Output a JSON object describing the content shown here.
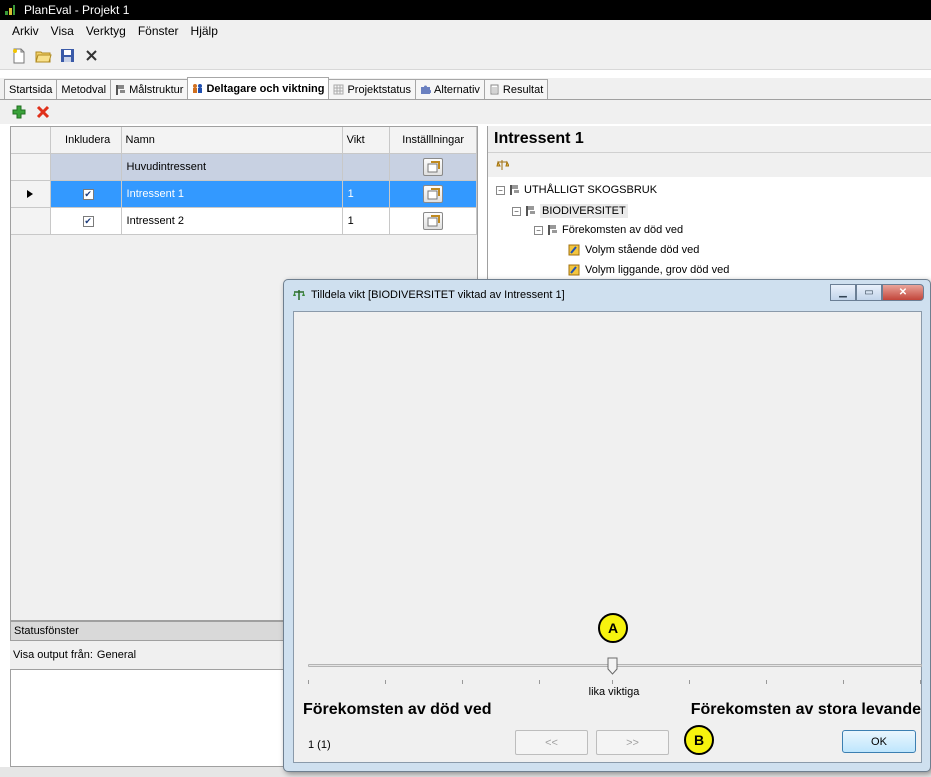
{
  "window": {
    "title": "PlanEval - Projekt 1"
  },
  "menu": [
    "Arkiv",
    "Visa",
    "Verktyg",
    "Fönster",
    "Hjälp"
  ],
  "tabs": [
    {
      "label": "Startsida",
      "icon": "none"
    },
    {
      "label": "Metodval",
      "icon": "none"
    },
    {
      "label": "Målstruktur",
      "icon": "hierarchy-icon"
    },
    {
      "label": "Deltagare och viktning",
      "icon": "participants-icon",
      "active": true
    },
    {
      "label": "Projektstatus",
      "icon": "grid-icon"
    },
    {
      "label": "Alternativ",
      "icon": "puzzle-icon"
    },
    {
      "label": "Resultat",
      "icon": "document-icon"
    }
  ],
  "grid": {
    "headers": [
      "Inkludera",
      "Namn",
      "Vikt",
      "Inställlningar"
    ],
    "rows": [
      {
        "name": "Huvudintressent",
        "vikt": "",
        "checked": null
      },
      {
        "name": "Intressent 1",
        "vikt": "1",
        "checked": true
      },
      {
        "name": "Intressent 2",
        "vikt": "1",
        "checked": true
      }
    ]
  },
  "status": {
    "title": "Statusfönster",
    "output_label": "Visa output från:",
    "output_value": "General"
  },
  "right_panel": {
    "title": "Intressent 1",
    "tree": [
      "UTHÅLLIGT SKOGSBRUK",
      "BIODIVERSITET",
      "Förekomsten av död ved",
      "Volym stående död ved",
      "Volym liggande, grov död ved"
    ]
  },
  "dialog": {
    "title": "Tilldela vikt [BIODIVERSITET viktad av Intressent 1]",
    "mid_label": "lika viktiga",
    "left_label": "Förekomsten av död ved",
    "right_label": "Förekomsten av stora levande",
    "counter": "1 (1)",
    "prev_label": "<<",
    "next_label": ">>",
    "ok_label": "OK",
    "slider_position": 0.5
  },
  "callouts": {
    "a": "A",
    "b": "B"
  },
  "colors": {
    "selection": "#3399ff",
    "callout": "#f7f30e"
  }
}
